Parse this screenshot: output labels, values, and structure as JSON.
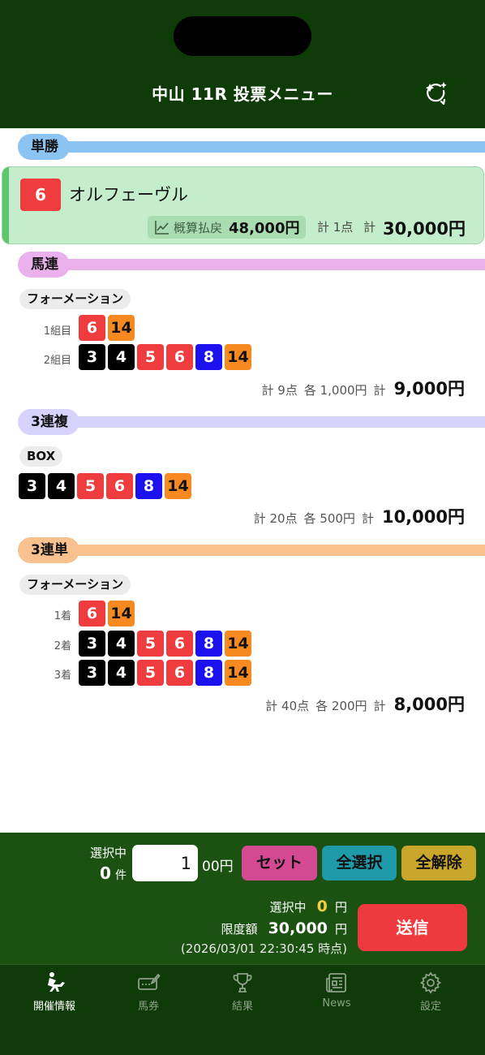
{
  "header": {
    "title": "中山 11R 投票メニュー",
    "action_icon": "sparkle-refresh-icon"
  },
  "colors": {
    "win": "#8bc3f2",
    "quinella": "#eab0ec",
    "trio": "#d6d2fb",
    "trifecta": "#f8c18e",
    "num_red": "#ef3c3f",
    "num_black": "#000000",
    "num_blue": "#1a11ee",
    "num_orange": "#f6891f"
  },
  "win": {
    "label": "単勝",
    "number": "6",
    "horse_name": "オルフェーヴル",
    "payout_label": "概算払戻",
    "payout_value": "48,000円",
    "points": "計 1点",
    "total_label": "計",
    "total": "30,000円"
  },
  "quinella": {
    "label": "馬連",
    "mode": "フォーメーション",
    "rows": [
      {
        "label": "1組目",
        "nums": [
          "6",
          "14"
        ]
      },
      {
        "label": "2組目",
        "nums": [
          "3",
          "4",
          "5",
          "6",
          "8",
          "14"
        ]
      }
    ],
    "points": "計 9点",
    "each": "各 1,000円",
    "total_label": "計",
    "total": "9,000円"
  },
  "trio": {
    "label": "3連複",
    "mode": "BOX",
    "nums": [
      "3",
      "4",
      "5",
      "6",
      "8",
      "14"
    ],
    "points": "計 20点",
    "each": "各 500円",
    "total_label": "計",
    "total": "10,000円"
  },
  "trifecta": {
    "label": "3連単",
    "mode": "フォーメーション",
    "rows": [
      {
        "label": "1着",
        "nums": [
          "6",
          "14"
        ]
      },
      {
        "label": "2着",
        "nums": [
          "3",
          "4",
          "5",
          "6",
          "8",
          "14"
        ]
      },
      {
        "label": "3着",
        "nums": [
          "3",
          "4",
          "5",
          "6",
          "8",
          "14"
        ]
      }
    ],
    "points": "計 40点",
    "each": "各 200円",
    "total_label": "計",
    "total": "8,000円"
  },
  "bottom": {
    "selecting_label": "選択中",
    "selecting_count": "0",
    "count_unit": "件",
    "amount_value": "1",
    "amount_suffix": "00円",
    "set_button": "セット",
    "select_all_button": "全選択",
    "clear_all_button": "全解除",
    "selected_label": "選択中",
    "selected_amount": "0",
    "limit_label": "限度額",
    "limit_amount": "30,000",
    "yen": "円",
    "timestamp": "(2026/03/01 22:30:45 時点)",
    "send_button": "送信"
  },
  "tabs": [
    {
      "label": "開催情報",
      "icon": "jockey-horse-icon",
      "active": true
    },
    {
      "label": "馬券",
      "icon": "ticket-pen-icon",
      "active": false
    },
    {
      "label": "結果",
      "icon": "trophy-icon",
      "active": false
    },
    {
      "label": "News",
      "icon": "newspaper-icon",
      "active": false
    },
    {
      "label": "設定",
      "icon": "gear-icon",
      "active": false
    }
  ]
}
